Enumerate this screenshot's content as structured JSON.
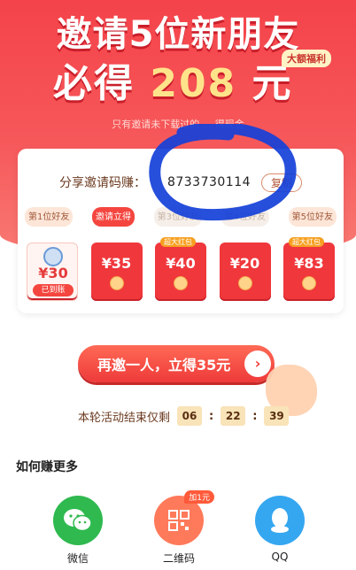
{
  "hero": {
    "title_line1": "邀请5位新朋友",
    "title_line2_prefix": "必得",
    "title_line2_amount": "208",
    "title_line2_suffix": "元",
    "bonus_badge": "大额福利",
    "subtitle": "只有邀请未下载过的 ... 得现金"
  },
  "invite": {
    "code_label": "分享邀请码赚：",
    "code_value": "8733730114",
    "copy_button": "复制"
  },
  "steps": [
    {
      "label": "第1位好友",
      "state": "normal"
    },
    {
      "label": "邀请立得",
      "state": "active"
    },
    {
      "label": "第3位好友",
      "state": "dim"
    },
    {
      "label": "第4位好友",
      "state": "dim"
    },
    {
      "label": "第5位好友",
      "state": "normal"
    }
  ],
  "envelopes": [
    {
      "amount": "¥30",
      "status": "已到账",
      "tag": ""
    },
    {
      "amount": "¥35",
      "status": "",
      "tag": ""
    },
    {
      "amount": "¥40",
      "status": "",
      "tag": "超大红包"
    },
    {
      "amount": "¥20",
      "status": "",
      "tag": ""
    },
    {
      "amount": "¥83",
      "status": "",
      "tag": "超大红包"
    }
  ],
  "cta": {
    "label": "再邀一人，立得35元",
    "arrow": "›"
  },
  "timer": {
    "label": "本轮活动结束仅剩",
    "hours": "06",
    "minutes": "22",
    "seconds": "39"
  },
  "more": {
    "title": "如何赚更多",
    "items": [
      {
        "label": "微信",
        "icon": "wechat-icon",
        "color": "#2fb94f"
      },
      {
        "label": "二维码",
        "icon": "qrcode-icon",
        "color": "#ff7a5a",
        "badge": "加1元"
      },
      {
        "label": "QQ",
        "icon": "qq-icon",
        "color": "#35a7f0"
      }
    ]
  },
  "colors": {
    "hero_red": "#f4434a",
    "gold": "#ffe38a",
    "scribble_blue": "#1440d8"
  }
}
